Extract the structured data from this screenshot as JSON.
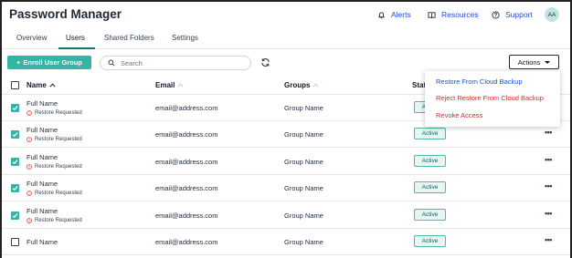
{
  "header": {
    "title": "Password Manager",
    "alerts": "Alerts",
    "resources": "Resources",
    "support": "Support",
    "avatar_initials": "AA"
  },
  "tabs": [
    {
      "label": "Overview",
      "active": false
    },
    {
      "label": "Users",
      "active": true
    },
    {
      "label": "Shared Folders",
      "active": false
    },
    {
      "label": "Settings",
      "active": false
    }
  ],
  "toolbar": {
    "enroll_label": "Enroll User Group",
    "search_placeholder": "Search",
    "actions_label": "Actions"
  },
  "actions_menu": {
    "items": [
      {
        "label": "Restore From Cloud Backup",
        "color": "#1d4ed8"
      },
      {
        "label": "Reject Restore From Cloud Backup",
        "color": "#dc2626"
      },
      {
        "label": "Revoke Access",
        "color": "#dc2626"
      }
    ]
  },
  "table": {
    "columns": [
      "Name",
      "Email",
      "Groups",
      "Status"
    ],
    "visible_status_header": "Stat",
    "rows": [
      {
        "checked": true,
        "name": "Full Name",
        "note": "Restore Requested",
        "email": "email@address.com",
        "group": "Group Name",
        "status": "Active"
      },
      {
        "checked": true,
        "name": "Full Name",
        "note": "Restore Requested",
        "email": "email@address.com",
        "group": "Group Name",
        "status": "Active"
      },
      {
        "checked": true,
        "name": "Full Name",
        "note": "Restore Requested",
        "email": "email@address.com",
        "group": "Group Name",
        "status": "Active"
      },
      {
        "checked": true,
        "name": "Full Name",
        "note": "Restore Requested",
        "email": "email@address.com",
        "group": "Group Name",
        "status": "Active"
      },
      {
        "checked": true,
        "name": "Full Name",
        "note": "Restore Requested",
        "email": "email@address.com",
        "group": "Group Name",
        "status": "Active"
      },
      {
        "checked": false,
        "name": "Full Name",
        "note": "",
        "email": "email@address.com",
        "group": "Group Name",
        "status": "Active"
      }
    ],
    "more_glyph": "•••"
  },
  "colors": {
    "accent": "#35b4a6",
    "link": "#1d4ed8",
    "danger": "#dc2626"
  }
}
